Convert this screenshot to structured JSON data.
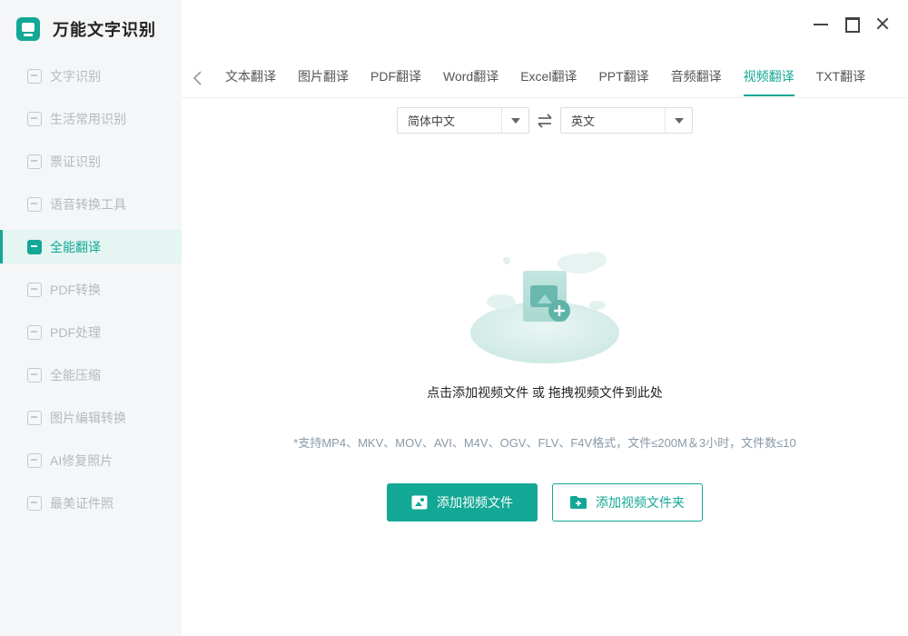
{
  "app": {
    "name": "万能文字识别"
  },
  "sidebar": {
    "items": [
      {
        "label": "文字识别",
        "icon": "scan-text-icon"
      },
      {
        "label": "生活常用识别",
        "icon": "scan-life-icon"
      },
      {
        "label": "票证识别",
        "icon": "scan-ticket-icon"
      },
      {
        "label": "语音转换工具",
        "icon": "audio-convert-icon"
      },
      {
        "label": "全能翻译",
        "icon": "translate-icon",
        "active": true
      },
      {
        "label": "PDF转换",
        "icon": "pdf-convert-icon"
      },
      {
        "label": "PDF处理",
        "icon": "pdf-process-icon"
      },
      {
        "label": "全能压缩",
        "icon": "compress-icon"
      },
      {
        "label": "图片编辑转换",
        "icon": "image-edit-icon"
      },
      {
        "label": "AI修复照片",
        "icon": "ai-repair-icon"
      },
      {
        "label": "最美证件照",
        "icon": "id-photo-icon"
      }
    ]
  },
  "tabs": [
    {
      "label": "文本翻译"
    },
    {
      "label": "图片翻译"
    },
    {
      "label": "PDF翻译"
    },
    {
      "label": "Word翻译"
    },
    {
      "label": "Excel翻译"
    },
    {
      "label": "PPT翻译"
    },
    {
      "label": "音频翻译"
    },
    {
      "label": "视频翻译",
      "active": true
    },
    {
      "label": "TXT翻译"
    }
  ],
  "language": {
    "source": "简体中文",
    "target": "英文"
  },
  "upload": {
    "hint": "点击添加视频文件 或 拖拽视频文件到此处",
    "support": "*支持MP4、MKV、MOV、AVI、M4V、OGV、FLV、F4V格式，文件≤200M＆3小时，文件数≤10",
    "add_file_label": "添加视频文件",
    "add_folder_label": "添加视频文件夹"
  },
  "colors": {
    "accent": "#13a796",
    "sidebar_bg": "#f5f6f7",
    "active_bg": "#e4f5f2"
  }
}
